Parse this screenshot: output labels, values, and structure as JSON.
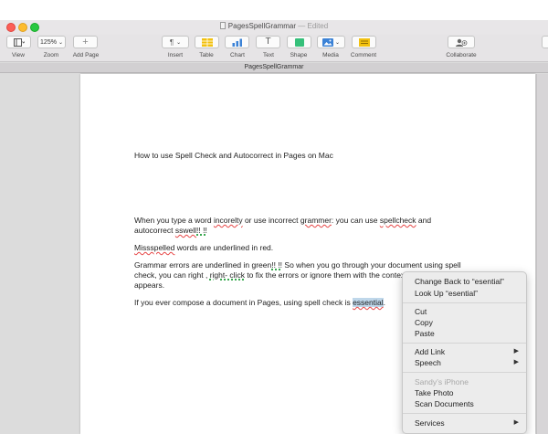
{
  "window": {
    "title": "PagesSpellGrammar",
    "title_status": "— Edited",
    "tab_title": "PagesSpellGrammar"
  },
  "toolbar": {
    "view_label": "View",
    "zoom_label": "Zoom",
    "zoom_value": "125%",
    "add_page_label": "Add Page",
    "insert_label": "Insert",
    "table_label": "Table",
    "chart_label": "Chart",
    "text_label": "Text",
    "shape_label": "Shape",
    "media_label": "Media",
    "comment_label": "Comment",
    "collaborate_label": "Collaborate"
  },
  "document": {
    "heading": "How to use Spell Check and Autocorrect in Pages on Mac",
    "p1_a": "When you type a word ",
    "p1_spell1": "incorelty",
    "p1_b": " or use incorrect ",
    "p1_spell2": "grammer",
    "p1_c": ": you can use ",
    "p1_spell3": "spellcheck",
    "p1_d": " and",
    "p1_line2_a": "autocorrect ",
    "p1_spell4": "sswell",
    "p1_grammar1": "!! !!",
    "p2_spell": "Missspelled",
    "p2_rest": " words are underlined in red.",
    "p3_a": "Grammar errors are underlined in green",
    "p3_grammar": "!! !!",
    "p3_b": " So when you go through your document using spell",
    "p3_line2_a": "check, you can right    , ",
    "p3_grammar2": "right- click",
    "p3_line2_b": " to fix the errors or ignore them with the context menu that",
    "p3_line3": "appears.",
    "p4_a": "If you ever compose a document in Pages, using spell check is ",
    "p4_selected": "essential",
    "p4_end": "."
  },
  "context_menu": {
    "change_back": "Change Back to “esential”",
    "look_up": "Look Up “esential”",
    "cut": "Cut",
    "copy": "Copy",
    "paste": "Paste",
    "add_link": "Add Link",
    "speech": "Speech",
    "device_name": "Sandy’s iPhone",
    "take_photo": "Take Photo",
    "scan_documents": "Scan Documents",
    "services": "Services",
    "submenu_arrow": "▶"
  },
  "colors": {
    "spell_underline": "#e64545",
    "grammar_underline": "#3aa850",
    "selection": "#bfd7ea",
    "table_icon": "#f2c10f",
    "chart_icon": "#3b82d6",
    "shape_icon": "#35c07a",
    "media_icon": "#3b82d6",
    "comment_icon": "#f2c10f"
  }
}
